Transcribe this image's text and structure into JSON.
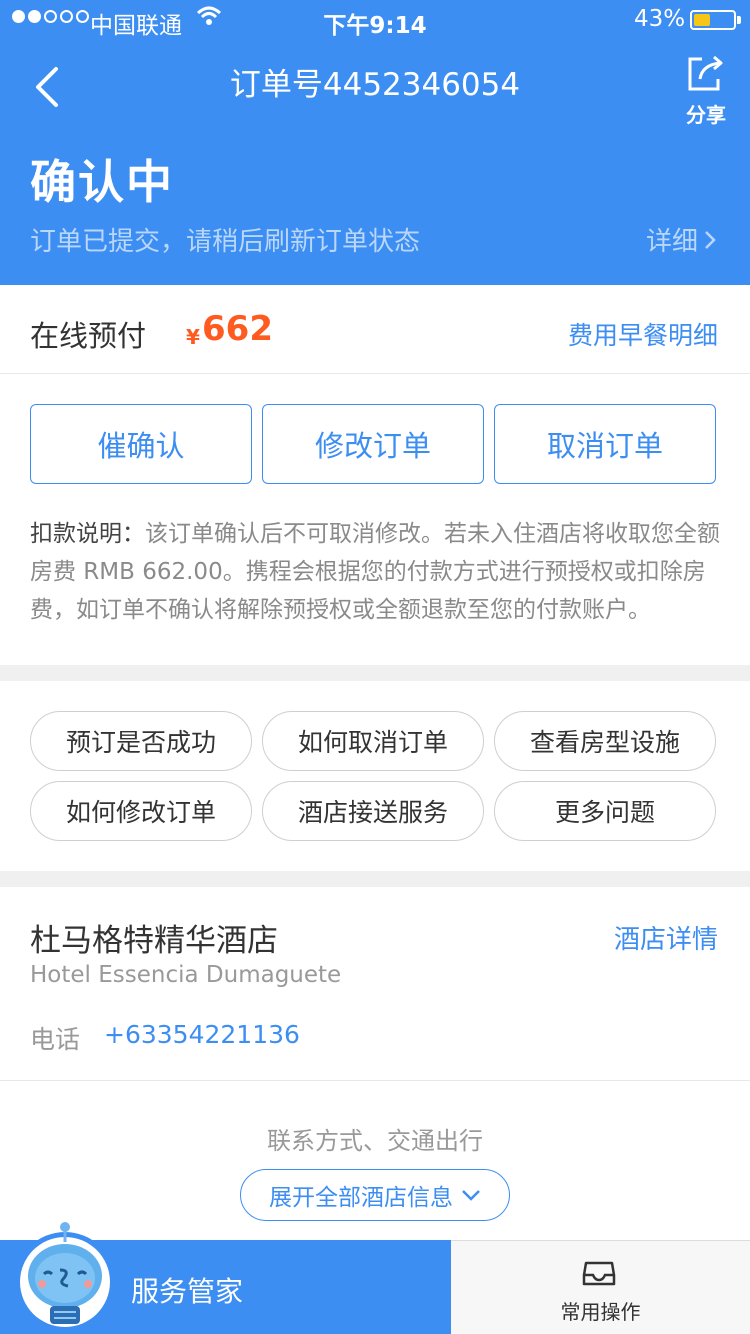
{
  "status_bar": {
    "carrier": "中国联通",
    "time": "下午9:14",
    "battery_percent": "43%",
    "battery_level": 0.43,
    "signal_bars": 2
  },
  "nav": {
    "title": "订单号4452346054",
    "share_label": "分享"
  },
  "order_status": {
    "title": "确认中",
    "subtitle": "订单已提交，请稍后刷新订单状态",
    "detail_link": "详细"
  },
  "payment": {
    "label": "在线预付",
    "currency": "¥",
    "amount": "662",
    "fee_link": "费用早餐明细"
  },
  "actions": [
    {
      "label": "催确认"
    },
    {
      "label": "修改订单"
    },
    {
      "label": "取消订单"
    }
  ],
  "deduction_note": {
    "label": "扣款说明：",
    "text": "该订单确认后不可取消修改。若未入住酒店将收取您全额房费 RMB 662.00。携程会根据您的付款方式进行预授权或扣除房费，如订单不确认将解除预授权或全额退款至您的付款账户。"
  },
  "faq": [
    {
      "label": "预订是否成功"
    },
    {
      "label": "如何取消订单"
    },
    {
      "label": "查看房型设施"
    },
    {
      "label": "如何修改订单"
    },
    {
      "label": "酒店接送服务"
    },
    {
      "label": "更多问题"
    }
  ],
  "hotel": {
    "name": "杜马格特精华酒店",
    "detail_link": "酒店详情",
    "name_en": "Hotel Essencia Dumaguete",
    "phone_label": "电话",
    "phone": "+63354221136",
    "contact_text": "联系方式、交通出行",
    "expand_label": "展开全部酒店信息"
  },
  "bottom_bar": {
    "assistant_label": "服务管家",
    "common_ops_label": "常用操作"
  },
  "colors": {
    "brand_blue": "#3d8ef2",
    "price_orange": "#ff5a1f"
  },
  "icons": [
    "back-arrow-icon",
    "share-icon",
    "chevron-right-icon",
    "chevron-down-icon",
    "robot-avatar-icon",
    "inbox-tray-icon",
    "wifi-icon"
  ]
}
